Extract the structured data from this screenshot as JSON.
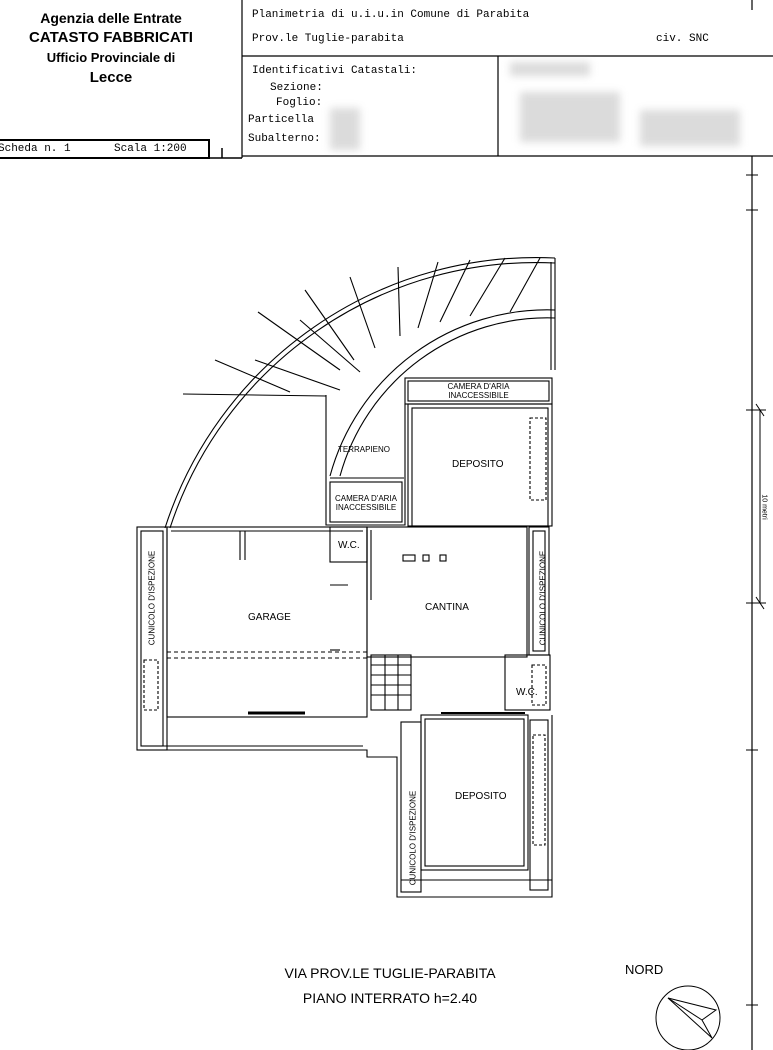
{
  "office": {
    "line1": "Agenzia delle Entrate",
    "line2": "CATASTO FABBRICATI",
    "line3": "Ufficio Provinciale di",
    "line4": "Lecce"
  },
  "scheda": {
    "number": "Scheda n. 1",
    "scale": "Scala 1:200"
  },
  "header": {
    "title": "Planimetria di u.i.u.in Comune di Parabita",
    "address": "Prov.le Tuglie-parabita",
    "civic": "civ. SNC"
  },
  "identificativi": {
    "heading": "Identificativi Catastali:",
    "sezione": "Sezione:",
    "foglio": "Foglio:",
    "particella": "Particella",
    "subalterno": "Subalterno:"
  },
  "rooms": {
    "camera_top_1": "CAMERA D'ARIA",
    "camera_top_2": "INACCESSIBILE",
    "terrapieno": "TERRAPIENO",
    "deposito_top": "DEPOSITO",
    "camera_mid_1": "CAMERA D'ARIA",
    "camera_mid_2": "INACCESSIBILE",
    "wc_1": "W.C.",
    "cantina": "CANTINA",
    "garage": "GARAGE",
    "wc_2": "W.C.",
    "deposito_bottom": "DEPOSITO",
    "cunicolo_left": "CUNICOLO D'ISPEZIONE",
    "cunicolo_right": "CUNICOLO D'ISPEZIONE",
    "cunicolo_bottom": "CUNICOLO D'ISPEZIONE"
  },
  "caption": {
    "line1": "VIA PROV.LE TUGLIE-PARABITA",
    "line2": "PIANO INTERRATO h=2.40"
  },
  "north_label": "NORD",
  "side_label": "10 metri"
}
